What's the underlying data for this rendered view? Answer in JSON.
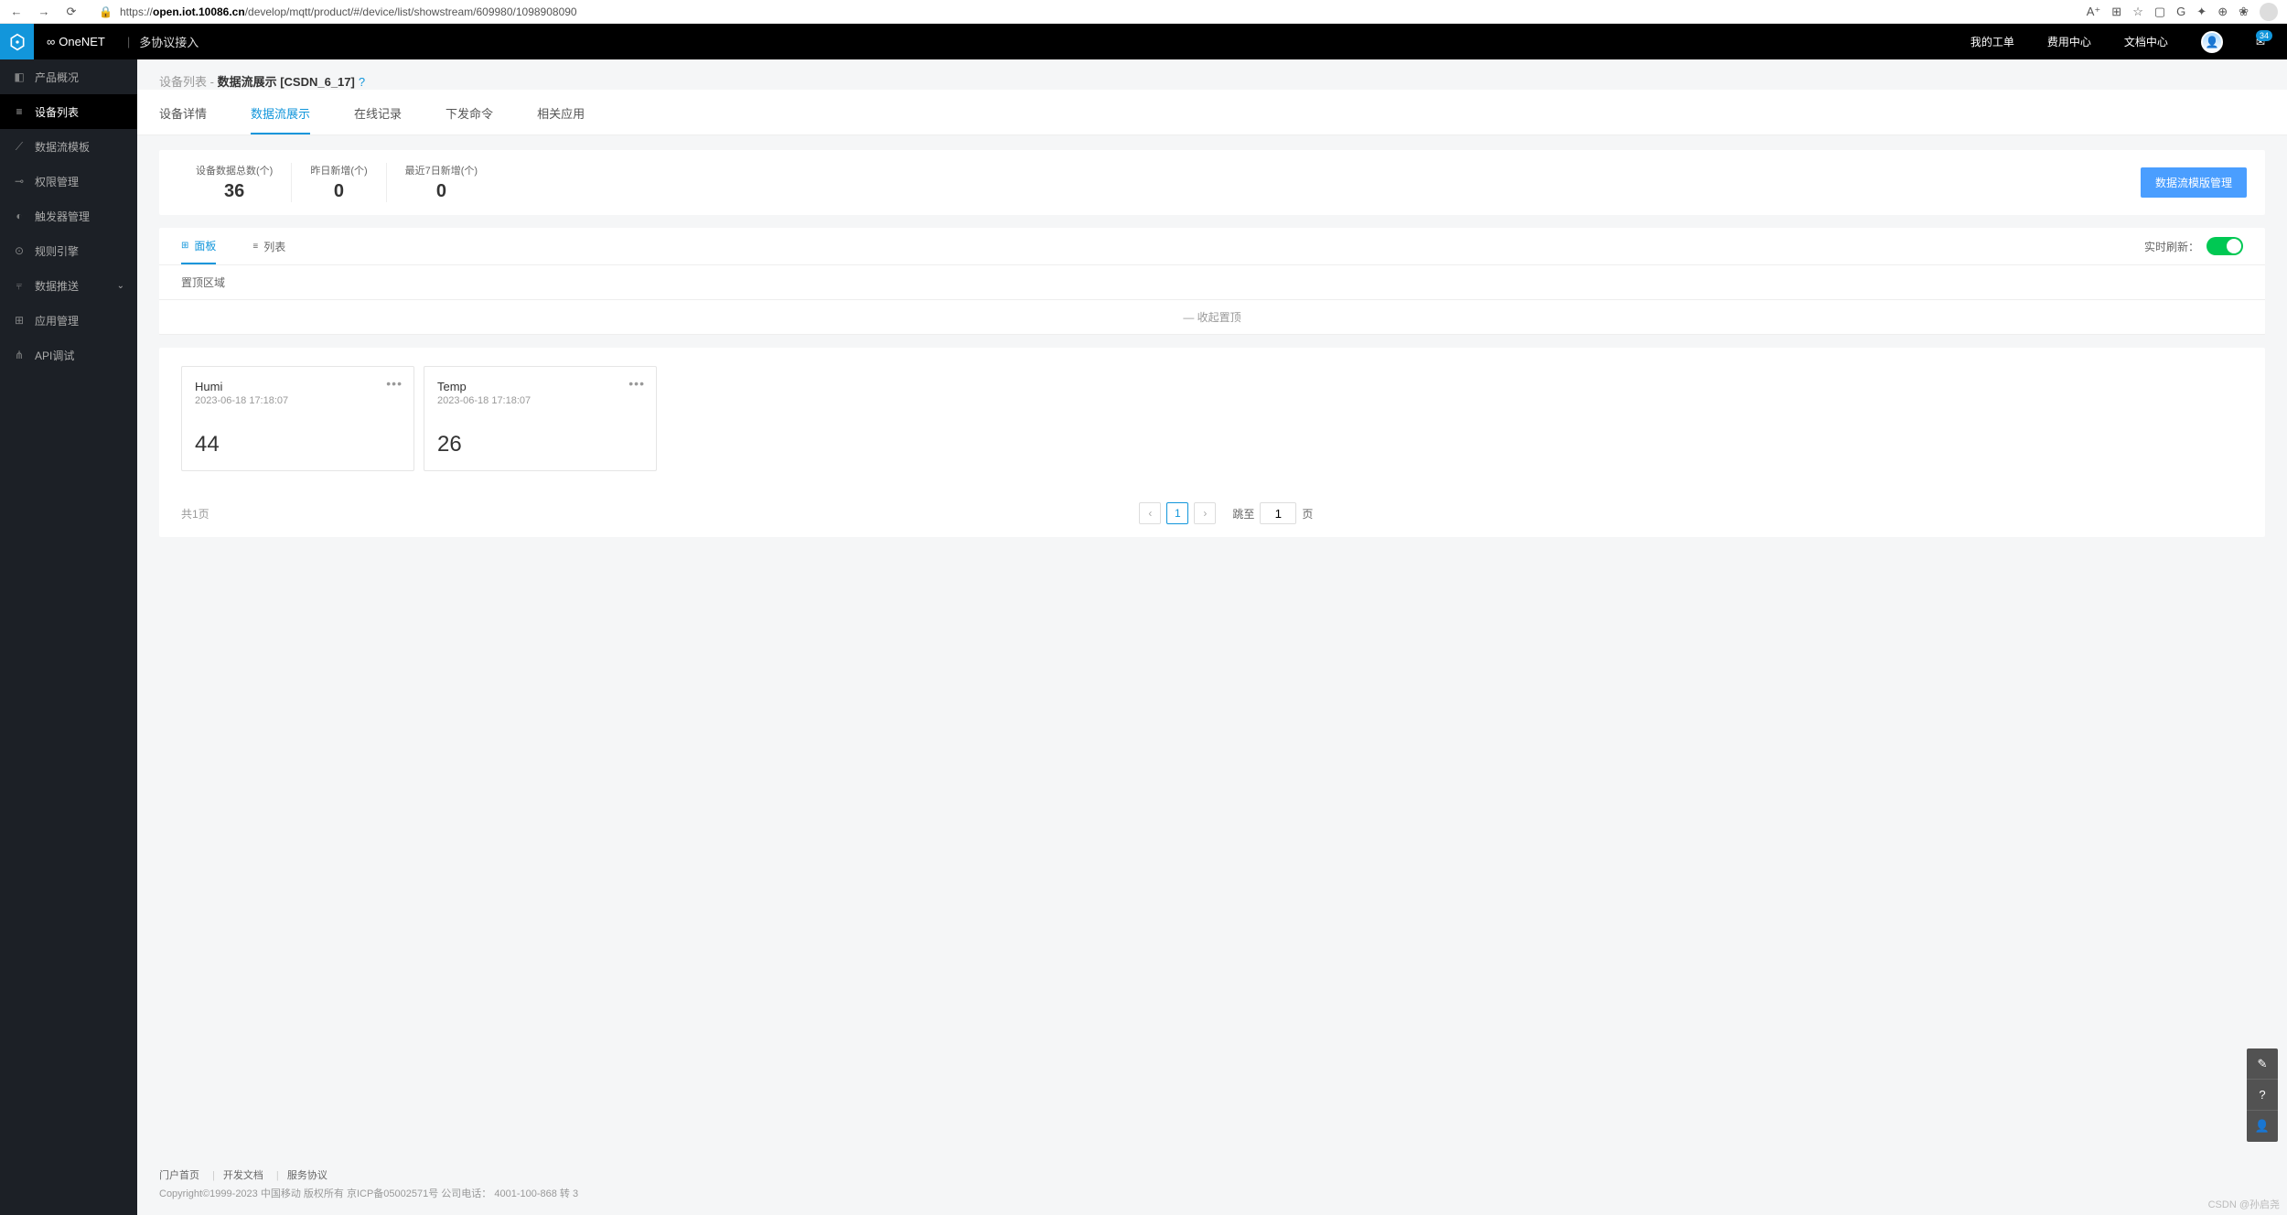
{
  "browser": {
    "url_prefix": "https://",
    "url_bold": "open.iot.10086.cn",
    "url_rest": "/develop/mqtt/product/#/device/list/showstream/609980/1098908090"
  },
  "header": {
    "brand": "OneNET",
    "sub": "多协议接入",
    "links": [
      "我的工单",
      "费用中心",
      "文档中心"
    ],
    "mail_badge": "34"
  },
  "sidebar": {
    "items": [
      {
        "label": "产品概况",
        "icon": "dashboard"
      },
      {
        "label": "设备列表",
        "icon": "list",
        "active": true
      },
      {
        "label": "数据流模板",
        "icon": "pulse"
      },
      {
        "label": "权限管理",
        "icon": "key"
      },
      {
        "label": "触发器管理",
        "icon": "gauge"
      },
      {
        "label": "规则引擎",
        "icon": "gear"
      },
      {
        "label": "数据推送",
        "icon": "chart",
        "expandable": true
      },
      {
        "label": "应用管理",
        "icon": "grid"
      },
      {
        "label": "API调试",
        "icon": "code"
      }
    ]
  },
  "breadcrumb": {
    "c1": "设备列表",
    "sep": " - ",
    "c2": "数据流展示 [CSDN_6_17]"
  },
  "tabs": [
    "设备详情",
    "数据流展示",
    "在线记录",
    "下发命令",
    "相关应用"
  ],
  "active_tab": 1,
  "stats": [
    {
      "label": "设备数据总数(个)",
      "value": "36"
    },
    {
      "label": "昨日新增(个)",
      "value": "0"
    },
    {
      "label": "最近7日新增(个)",
      "value": "0"
    }
  ],
  "stats_btn": "数据流模版管理",
  "panel_tabs": {
    "panel": "面板",
    "list": "列表"
  },
  "realtime_label": "实时刷新：",
  "pin_label": "置顶区域",
  "collapse_label": "— 收起置顶",
  "cards": [
    {
      "title": "Humi",
      "time": "2023-06-18 17:18:07",
      "value": "44"
    },
    {
      "title": "Temp",
      "time": "2023-06-18 17:18:07",
      "value": "26"
    }
  ],
  "pagination": {
    "total": "共1页",
    "page": "1",
    "jump_label": "跳至",
    "page_suffix": "页",
    "input": "1"
  },
  "footer": {
    "links": [
      "门户首页",
      "开发文档",
      "服务协议"
    ],
    "copyright": "Copyright©1999-2023 中国移动 版权所有 京ICP备05002571号 公司电话： 4001-100-868 转 3"
  },
  "watermark": "CSDN @孙启尧"
}
